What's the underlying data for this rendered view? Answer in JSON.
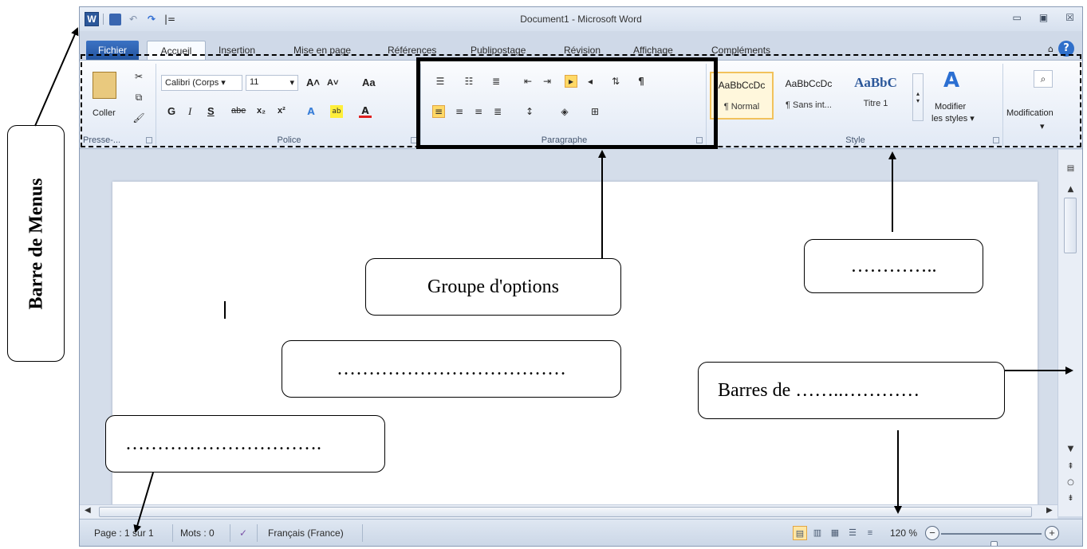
{
  "window": {
    "title": "Document1 - Microsoft Word",
    "qat": {
      "logo": "W",
      "undo": "↶",
      "redo": "↷",
      "customize": "|="
    },
    "controls": {
      "minimize": "▭",
      "maximize": "▣",
      "close": "☒"
    }
  },
  "tabs": {
    "file": "Fichier",
    "home": "Accueil",
    "insert": "Insertion",
    "layout": "Mise en page",
    "references": "Références",
    "mailings": "Publipostage",
    "review": "Révision",
    "view": "Affichage",
    "addins": "Compléments",
    "help": "?"
  },
  "ribbon": {
    "clipboard": {
      "paste": "Coller",
      "label": "Presse-..."
    },
    "font": {
      "label": "Police",
      "font_name": "Calibri (Corps",
      "font_size": "11",
      "grow": "A˄",
      "shrink": "A˅",
      "case": "Aa",
      "bold": "G",
      "italic": "I",
      "underline": "S",
      "strike": "abe",
      "sub": "x₂",
      "sup": "x²"
    },
    "paragraph": {
      "label": "Paragraphe",
      "pilcrow": "¶"
    },
    "styles": {
      "label": "Style",
      "tiles": [
        {
          "sample": "AaBbCcDc",
          "name": "¶ Normal"
        },
        {
          "sample": "AaBbCcDc",
          "name": "¶ Sans int..."
        },
        {
          "sample": "AaBbC",
          "name": "Titre 1"
        }
      ],
      "change_styles_1": "Modifier",
      "change_styles_2": "les styles ▾"
    },
    "editing": {
      "label": "Modification"
    }
  },
  "status": {
    "page": "Page : 1 sur 1",
    "words": "Mots : 0",
    "language": "Français (France)",
    "zoom": "120 %",
    "zoom_minus": "−",
    "zoom_plus": "+",
    "zoom_level_percent": 120
  },
  "annotations": {
    "menu_bar": "Barre de Menus",
    "option_group": "Groupe d'options",
    "blank_styles": "…………..",
    "blank_middle": "………………………………",
    "scroll_bars": "Barres de ……..…………",
    "blank_bottom": "…………………………."
  },
  "colors": {
    "accent": "#2b579a",
    "file_tab": "#2d62b3",
    "ribbon": "#e1e9f5",
    "doc_bg": "#d4ddea"
  }
}
